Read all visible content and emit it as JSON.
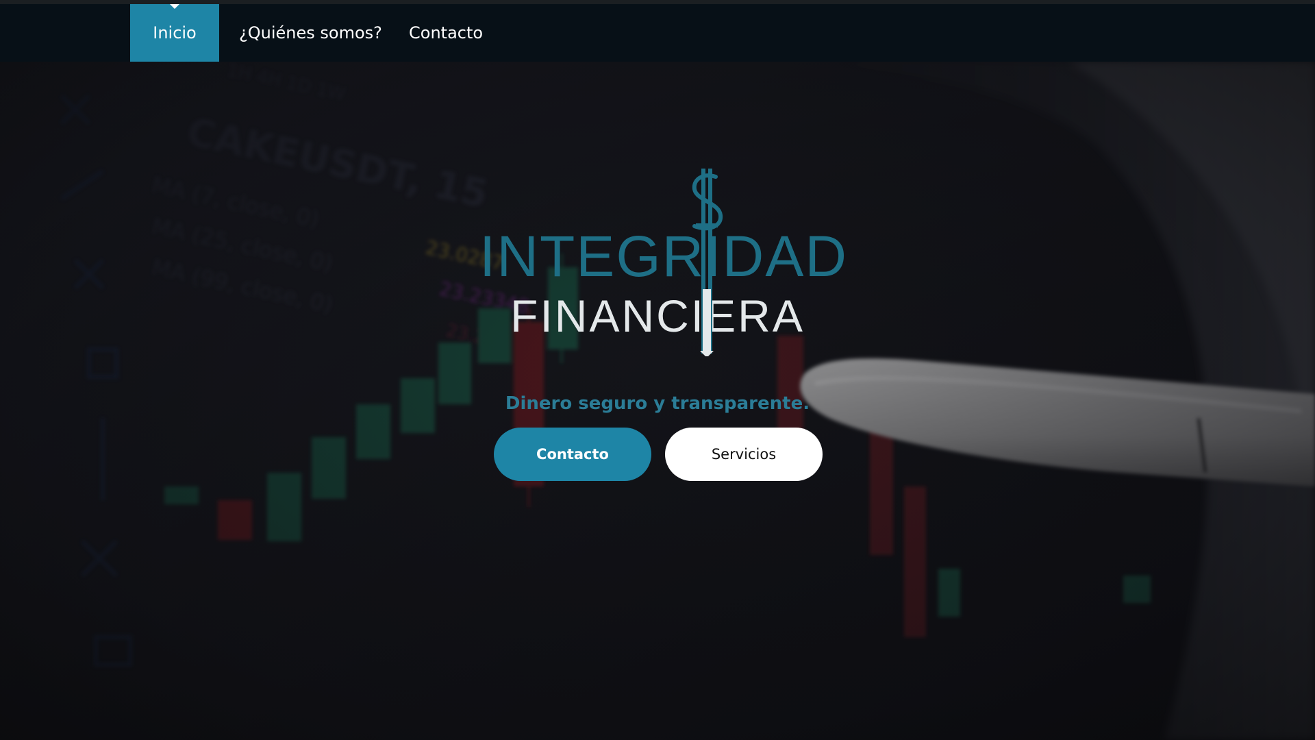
{
  "nav": {
    "items": [
      {
        "label": "Inicio",
        "active": true
      },
      {
        "label": "¿Quiénes somos?",
        "active": false
      },
      {
        "label": "Contacto",
        "active": false
      }
    ]
  },
  "hero": {
    "background_icon": "trading-chart-with-pen-photo",
    "logo": {
      "line1": "INTEGRIDAD",
      "line2": "FINANCIERA",
      "mark_icon": "dollar-sword-icon"
    },
    "tagline": "Dinero seguro y transparente.",
    "buttons": {
      "primary_label": "Contacto",
      "secondary_label": "Servicios"
    }
  },
  "colors": {
    "accent": "#1e85a6",
    "logo_teal": "#1e6f86",
    "nav_bg": "#071017"
  }
}
